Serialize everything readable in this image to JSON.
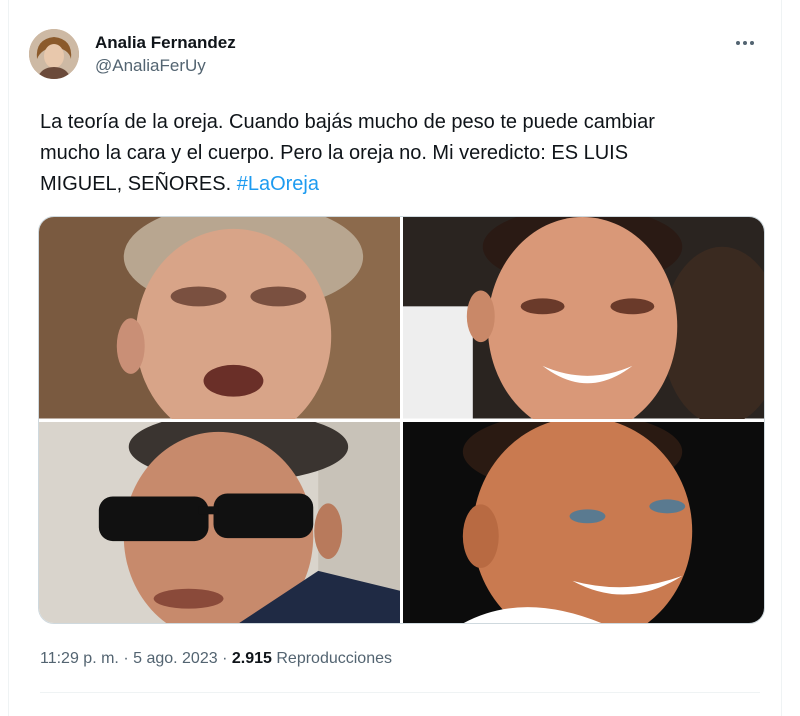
{
  "tweet": {
    "display_name": "Analia Fernandez",
    "handle": "@AnaliaFerUy",
    "text": "La teoría de la oreja. Cuando bajás mucho de peso te puede cambiar\nmucho la cara y el cuerpo. Pero la oreja no. Mi veredicto: ES LUIS\nMIGUEL, SEÑORES. ",
    "hashtag": "#LaOreja",
    "time": "11:29 p. m.",
    "separator": "·",
    "date": "5 ago. 2023",
    "views_count": "2.915",
    "views_label": "Reproducciones"
  },
  "icons": {
    "more": "more-horizontal-icon"
  },
  "colors": {
    "link": "#1d9bf0",
    "secondary_text": "#536471",
    "primary_text": "#0f1419",
    "border": "#cfd9de"
  }
}
